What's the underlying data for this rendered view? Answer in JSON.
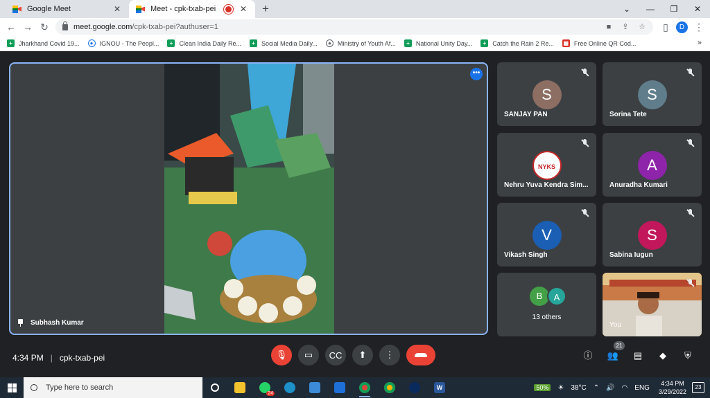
{
  "browser": {
    "tabs": [
      {
        "title": "Google Meet",
        "active": false
      },
      {
        "title": "Meet - cpk-txab-pei",
        "active": true
      }
    ],
    "url_host": "meet.google.com",
    "url_path": "/cpk-txab-pei?authuser=1",
    "profile_initial": "D",
    "bookmarks": [
      {
        "label": "Jharkhand Covid 19...",
        "icon": "sheet-icon"
      },
      {
        "label": "IGNOU - The Peopl...",
        "icon": "ignou-icon"
      },
      {
        "label": "Clean India Daily Re...",
        "icon": "sheet-icon"
      },
      {
        "label": "Social Media Daily...",
        "icon": "sheet-icon"
      },
      {
        "label": "Ministry of Youth Af...",
        "icon": "globe-icon"
      },
      {
        "label": "National Unity Day...",
        "icon": "sheet-icon"
      },
      {
        "label": "Catch the Rain 2 Re...",
        "icon": "sheet-icon"
      },
      {
        "label": "Free Online QR Cod...",
        "icon": "qr-icon"
      }
    ]
  },
  "meet": {
    "presenter": "Subhash Kumar",
    "participants": [
      {
        "name": "SANJAY PAN",
        "initial": "S",
        "color": "#795548"
      },
      {
        "name": "Sorina Tete",
        "initial": "S",
        "color": "#607d8b"
      },
      {
        "name": "Nehru Yuva Kendra Sim...",
        "initial": "NYKS",
        "color": "#ffffff"
      },
      {
        "name": "Anuradha Kumari",
        "initial": "A",
        "color": "#8e24aa"
      },
      {
        "name": "Vikash Singh",
        "initial": "V",
        "color": "#1a5fb4"
      },
      {
        "name": "Sabina Iugun",
        "initial": "S",
        "color": "#c2185b"
      }
    ],
    "others": {
      "label": "13 others",
      "avatars": [
        {
          "initial": "B",
          "color": "#43a047"
        },
        {
          "initial": "A",
          "color": "#26a69a"
        }
      ]
    },
    "self_label": "You",
    "time": "4:34 PM",
    "meeting_code": "cpk-txab-pei",
    "people_count": "21"
  },
  "taskbar": {
    "search_placeholder": "Type here to search",
    "whatsapp_badge": "24",
    "battery": "50%",
    "weather": "38°C",
    "lang": "ENG",
    "time": "4:34 PM",
    "date": "3/29/2022",
    "notifications": "23"
  }
}
